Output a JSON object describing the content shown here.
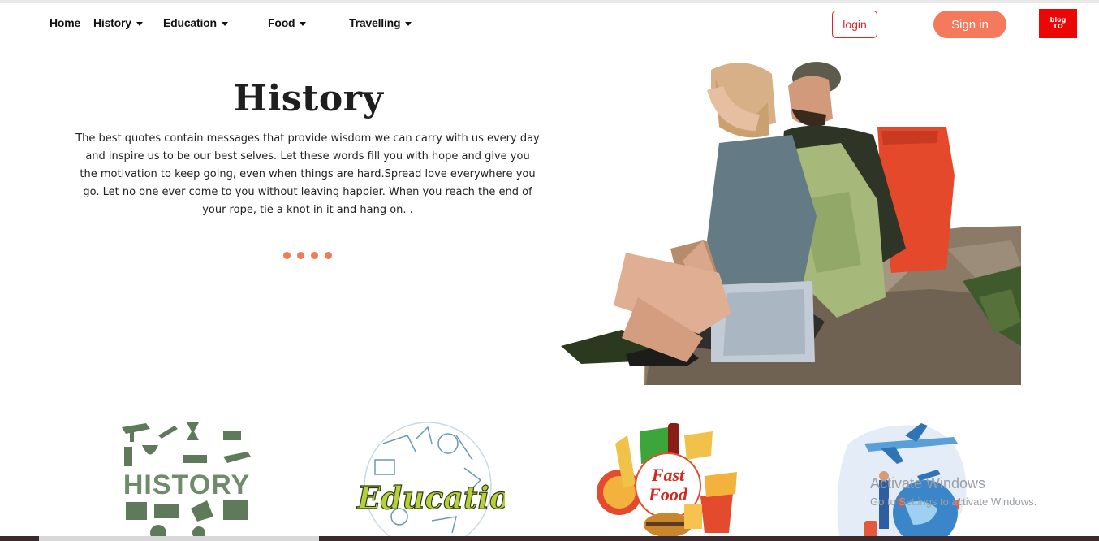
{
  "nav": {
    "items": [
      {
        "label": "Home",
        "dropdown": false
      },
      {
        "label": "History",
        "dropdown": true
      },
      {
        "label": "Education",
        "dropdown": true
      },
      {
        "label": "Food",
        "dropdown": true
      },
      {
        "label": "Travelling",
        "dropdown": true
      }
    ],
    "login_label": "login",
    "signin_label": "Sign in",
    "logo_line1": "blog",
    "logo_line2": "TO"
  },
  "hero": {
    "title": "History",
    "text": "The best quotes contain messages that provide wisdom we can carry with us every day and inspire us to be our best selves. Let these words fill you with hope and give you the motivation to keep going, even when things are hard.Spread love everywhere you go. Let no one ever come to you without leaving happier. When you reach the end of your rope, tie a knot in it and hang on. .",
    "slides": 4,
    "photo": "couple-hiking-photo"
  },
  "categories": [
    {
      "name": "history",
      "image_text": "HISTORY"
    },
    {
      "name": "education",
      "image_text": "Education"
    },
    {
      "name": "food",
      "image_text_1": "Fast",
      "image_text_2": "Food"
    },
    {
      "name": "travelling"
    }
  ],
  "overlay": {
    "line1": "Activate Windows",
    "line2": "Go to Settings to activate Windows."
  },
  "colors": {
    "accent": "#f5795b",
    "login_border": "#d8262b",
    "logo_bg": "#ec0707",
    "dot": "#f07a5a"
  }
}
